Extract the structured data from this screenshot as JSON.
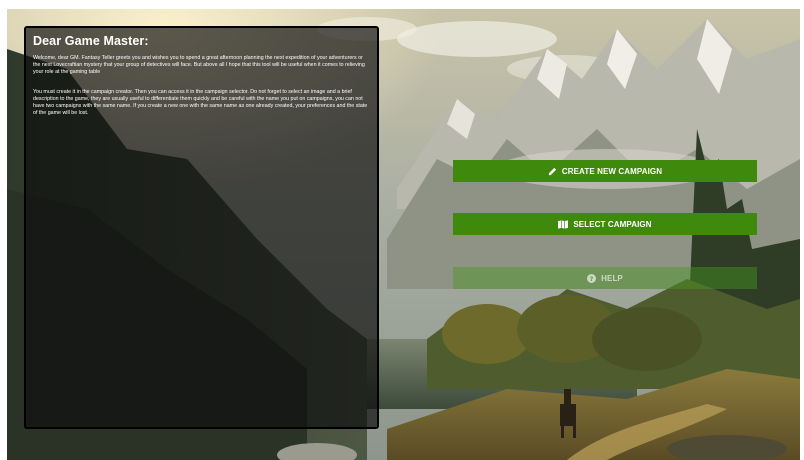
{
  "intro": {
    "title": "Dear Game Master:",
    "paragraph_1": "Welcome, dear GM. Fantasy Teller greets you and wishes you to spend a great afternoon planning the next expedition of your adventurers or the next Lovecraftian mystery that your group of detectives will face. But above all I hope that this tool will be useful when it comes to relieving your role at the gaming table",
    "paragraph_2": "You must create it in the campaign creator. Then you can access it in the campaign selector. Do not forget to select an image and a brief description to the game, they are usually useful to differentiate them quickly and be careful with the name you put on campaigns, you can not have two campaigns with the same name. If you create a new one with the same name as one already created, your preferences and the state of the game will be lost."
  },
  "actions": {
    "create_label": "CREATE NEW CAMPAIGN",
    "create_icon": "pencil-icon",
    "select_label": "SELECT CAMPAIGN",
    "select_icon": "map-icon",
    "help_label": "HELP",
    "help_icon": "help-circle-icon"
  },
  "colors": {
    "button_green": "#3f8a0d",
    "panel_background": "rgba(14,14,14,0.68)"
  }
}
